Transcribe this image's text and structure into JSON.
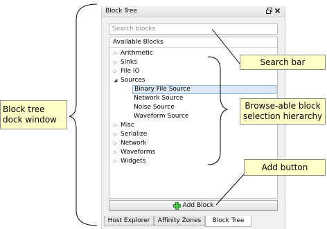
{
  "dock": {
    "title": "Block Tree",
    "float_icon": "window-restore-icon",
    "close_icon": "close-icon"
  },
  "search": {
    "placeholder": "Search blocks"
  },
  "tree": {
    "header": "Available Blocks",
    "categories": [
      {
        "label": "Arithmetic",
        "expanded": false
      },
      {
        "label": "Sinks",
        "expanded": false
      },
      {
        "label": "File IO",
        "expanded": false
      },
      {
        "label": "Sources",
        "expanded": true,
        "children": [
          "Binary File Source",
          "Network Source",
          "Noise Source",
          "Waveform Source"
        ]
      },
      {
        "label": "Misc",
        "expanded": false
      },
      {
        "label": "Serialize",
        "expanded": false
      },
      {
        "label": "Network",
        "expanded": false
      },
      {
        "label": "Waveforms",
        "expanded": false
      },
      {
        "label": "Widgets",
        "expanded": false
      }
    ],
    "selected": "Binary File Source"
  },
  "add_block": {
    "label": "Add Block",
    "icon": "plus-icon"
  },
  "tabs": [
    {
      "label": "Host Explorer",
      "active": false
    },
    {
      "label": "Affinity Zones",
      "active": false
    },
    {
      "label": "Block Tree",
      "active": true
    }
  ],
  "callouts": {
    "search_bar": "Search bar",
    "browse_line1": "Browse-able block",
    "browse_line2": "selection hierarchy",
    "add_button": "Add button",
    "dock_line1": "Block tree",
    "dock_line2": "dock window"
  },
  "colors": {
    "callout_bg": "#ffffc8",
    "selection_bg": "#dde9f7",
    "plus_green": "#3aa43a"
  }
}
